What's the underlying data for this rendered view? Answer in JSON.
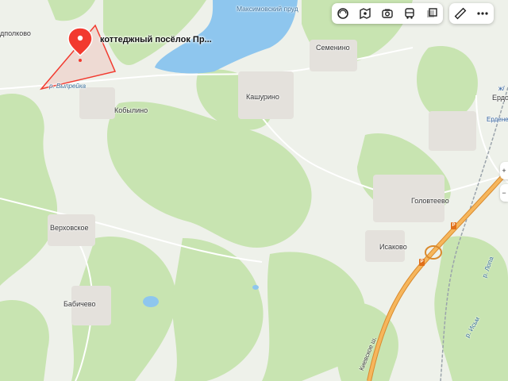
{
  "marker": {
    "label": "коттеджный посёлок Пр...",
    "icon": "location-pin-icon",
    "color": "#f23a2f"
  },
  "toolbar": {
    "left_buttons": [
      {
        "name": "layers-button",
        "icon": "layers-icon"
      },
      {
        "name": "panorama-button",
        "icon": "panorama-icon"
      },
      {
        "name": "photo-button",
        "icon": "camera-icon"
      },
      {
        "name": "transit-button",
        "icon": "bus-icon"
      },
      {
        "name": "map-type-button",
        "icon": "map-type-icon"
      }
    ],
    "right_buttons": [
      {
        "name": "ruler-button",
        "icon": "ruler-icon"
      },
      {
        "name": "more-button",
        "icon": "more-icon"
      }
    ]
  },
  "places": {
    "edge_left": "дполково",
    "pond": "Максимовский пруд",
    "semenino": "Семенино",
    "vypreyka": "р. Выпрейка",
    "kobylino": "Кобылино",
    "kashurino": "Кашурино",
    "erd_station": "ж/",
    "erd": "Ердо",
    "erdenevo": "Ерденев",
    "golovteevo": "Головтеево",
    "verkhovskoe": "Верховское",
    "isakovo": "Исаково",
    "babichevo": "Бабичево",
    "kievskoe": "Киевское ш.",
    "lopasnya": "р. Лопа",
    "river_lower": "р. Исьм"
  },
  "colors": {
    "forest": "#c9e5b3",
    "field": "#eef1ea",
    "water": "#8fc7ee",
    "highway": "#f3a54a",
    "marker": "#f23a2f"
  }
}
